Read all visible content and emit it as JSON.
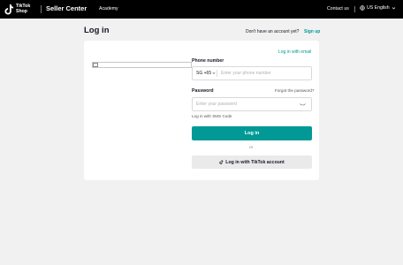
{
  "header": {
    "logo_text": "TikTok Shop",
    "app_name": "Seller Center",
    "nav_academy": "Academy",
    "contact": "Contact us",
    "language": "US English"
  },
  "login": {
    "title": "Log in",
    "no_account_text": "Don't have an account yet?",
    "signup_link": "Sign up",
    "email_link": "Log in with email",
    "phone_label": "Phone number",
    "country_code": "SG +65",
    "phone_placeholder": "Enter your phone number",
    "password_label": "Password",
    "forgot_link": "Forgot the password?",
    "password_placeholder": "Enter your password",
    "sms_link": "Log in with SMS Code",
    "login_button": "Log in",
    "or_text": "or",
    "tiktok_button": "Log in with TikTok account"
  },
  "colors": {
    "accent": "#009995",
    "topbar": "#000000"
  }
}
